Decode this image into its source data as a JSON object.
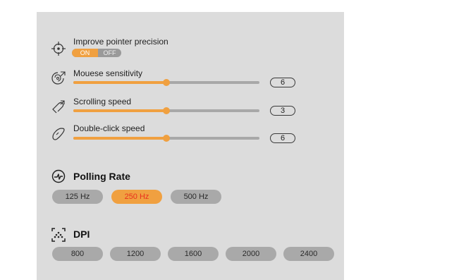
{
  "pointer_precision": {
    "label": "Improve pointer precision",
    "icon": "crosshair-icon",
    "toggle": {
      "on_label": "ON",
      "off_label": "OFF",
      "state": "on"
    }
  },
  "sliders": [
    {
      "id": "mouse-sensitivity",
      "label": "Mouese sensitivity",
      "icon": "mouse-speed-icon",
      "value": "6",
      "fraction": 0.5
    },
    {
      "id": "scrolling-speed",
      "label": "Scrolling speed",
      "icon": "scroll-icon",
      "value": "3",
      "fraction": 0.5
    },
    {
      "id": "double-click-speed",
      "label": "Double-click speed",
      "icon": "double-click-icon",
      "value": "6",
      "fraction": 0.5
    }
  ],
  "polling_rate": {
    "title": "Polling Rate",
    "icon": "polling-rate-icon",
    "options": [
      "125 Hz",
      "250 Hz",
      "500 Hz"
    ],
    "selected": "250 Hz"
  },
  "dpi": {
    "title": "DPI",
    "icon": "dpi-icon",
    "options": [
      "800",
      "1200",
      "1600",
      "2000",
      "2400"
    ]
  },
  "colors": {
    "panel": "#dcdcdc",
    "accent": "#f0a040",
    "active_text": "#e8301e",
    "track": "#a8a8a8",
    "pill": "#a9a9a9"
  }
}
